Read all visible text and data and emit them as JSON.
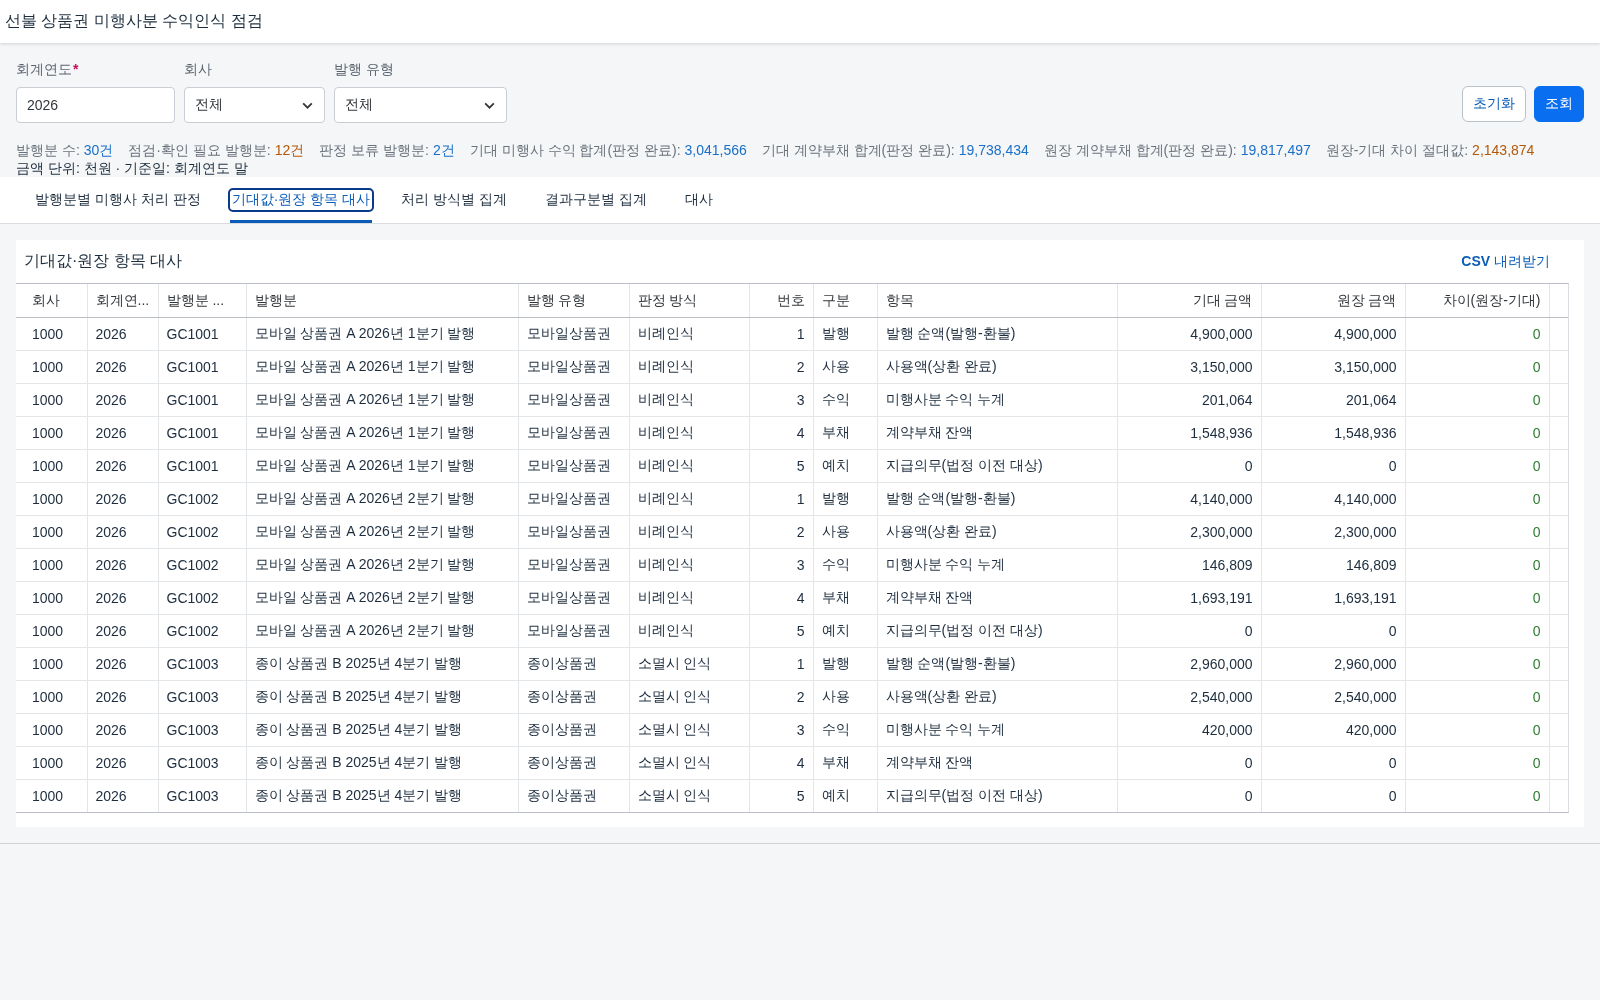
{
  "window": {
    "title": "선불 상품권 미행사분 수익인식 점검"
  },
  "filters": [
    {
      "label": "회계연도",
      "required_mark": "*",
      "kind": "input",
      "value": "2026"
    },
    {
      "label": "회사",
      "kind": "select",
      "value": "전체"
    },
    {
      "label": "발행 유형",
      "kind": "select",
      "value": "전체"
    }
  ],
  "actions": [
    {
      "label": "초기화",
      "kind": "secondary"
    },
    {
      "label": "조회",
      "kind": "primary"
    }
  ],
  "summary": [
    {
      "label": "발행분 수:",
      "value": "30건",
      "color": "#1a6fc9"
    },
    {
      "label": "점검·확인 필요 발행분:",
      "value": "12건",
      "color": "#b4580a"
    },
    {
      "label": "판정 보류 발행분:",
      "value": "2건",
      "color": "#1a6fc9"
    },
    {
      "label": "기대 미행사 수익 합계(판정 완료):",
      "value": "3,041,566",
      "color": "#1a6fc9"
    },
    {
      "label": "기대 계약부채 합계(판정 완료):",
      "value": "19,738,434",
      "color": "#1a6fc9"
    },
    {
      "label": "원장 계약부채 합계(판정 완료):",
      "value": "19,817,497",
      "color": "#1a6fc9"
    },
    {
      "label": "원장-기대 차이 절대값:",
      "value": "2,143,874",
      "color": "#b4580a"
    }
  ],
  "note": "금액 단위: 천원 · 기준일: 회계연도 말",
  "tabs": [
    {
      "label": "발행분별 미행사 처리 판정",
      "selected": false
    },
    {
      "label": "기대값·원장 항목 대사",
      "selected": true
    },
    {
      "label": "처리 방식별 집계",
      "selected": false
    },
    {
      "label": "결과구분별 집계",
      "selected": false
    },
    {
      "label": "대사",
      "selected": false
    }
  ],
  "panel": {
    "title": "기대값·원장 항목 대사",
    "export_link": {
      "bold": "CSV",
      "text": "내려받기"
    }
  },
  "table": {
    "columns": [
      {
        "label": "회사",
        "kind": "text"
      },
      {
        "label": "회계연...",
        "kind": "text"
      },
      {
        "label": "발행분 ...",
        "kind": "text"
      },
      {
        "label": "발행분",
        "kind": "text"
      },
      {
        "label": "발행 유형",
        "kind": "text"
      },
      {
        "label": "판정 방식",
        "kind": "text"
      },
      {
        "label": "번호",
        "kind": "number"
      },
      {
        "label": "구분",
        "kind": "text"
      },
      {
        "label": "항목",
        "kind": "text"
      },
      {
        "label": "기대 금액",
        "kind": "number"
      },
      {
        "label": "원장 금액",
        "kind": "number"
      },
      {
        "label": "차이(원장-기대)",
        "kind": "diff"
      }
    ],
    "rows": [
      [
        "1000",
        "2026",
        "GC1001",
        "모바일 상품권 A 2026년 1분기 발행",
        "모바일상품권",
        "비례인식",
        "1",
        "발행",
        "발행 순액(발행-환불)",
        "4,900,000",
        "4,900,000",
        "0"
      ],
      [
        "1000",
        "2026",
        "GC1001",
        "모바일 상품권 A 2026년 1분기 발행",
        "모바일상품권",
        "비례인식",
        "2",
        "사용",
        "사용액(상환 완료)",
        "3,150,000",
        "3,150,000",
        "0"
      ],
      [
        "1000",
        "2026",
        "GC1001",
        "모바일 상품권 A 2026년 1분기 발행",
        "모바일상품권",
        "비례인식",
        "3",
        "수익",
        "미행사분 수익 누계",
        "201,064",
        "201,064",
        "0"
      ],
      [
        "1000",
        "2026",
        "GC1001",
        "모바일 상품권 A 2026년 1분기 발행",
        "모바일상품권",
        "비례인식",
        "4",
        "부채",
        "계약부채 잔액",
        "1,548,936",
        "1,548,936",
        "0"
      ],
      [
        "1000",
        "2026",
        "GC1001",
        "모바일 상품권 A 2026년 1분기 발행",
        "모바일상품권",
        "비례인식",
        "5",
        "예치",
        "지급의무(법정 이전 대상)",
        "0",
        "0",
        "0"
      ],
      [
        "1000",
        "2026",
        "GC1002",
        "모바일 상품권 A 2026년 2분기 발행",
        "모바일상품권",
        "비례인식",
        "1",
        "발행",
        "발행 순액(발행-환불)",
        "4,140,000",
        "4,140,000",
        "0"
      ],
      [
        "1000",
        "2026",
        "GC1002",
        "모바일 상품권 A 2026년 2분기 발행",
        "모바일상품권",
        "비례인식",
        "2",
        "사용",
        "사용액(상환 완료)",
        "2,300,000",
        "2,300,000",
        "0"
      ],
      [
        "1000",
        "2026",
        "GC1002",
        "모바일 상품권 A 2026년 2분기 발행",
        "모바일상품권",
        "비례인식",
        "3",
        "수익",
        "미행사분 수익 누계",
        "146,809",
        "146,809",
        "0"
      ],
      [
        "1000",
        "2026",
        "GC1002",
        "모바일 상품권 A 2026년 2분기 발행",
        "모바일상품권",
        "비례인식",
        "4",
        "부채",
        "계약부채 잔액",
        "1,693,191",
        "1,693,191",
        "0"
      ],
      [
        "1000",
        "2026",
        "GC1002",
        "모바일 상품권 A 2026년 2분기 발행",
        "모바일상품권",
        "비례인식",
        "5",
        "예치",
        "지급의무(법정 이전 대상)",
        "0",
        "0",
        "0"
      ],
      [
        "1000",
        "2026",
        "GC1003",
        "종이 상품권 B 2025년 4분기 발행",
        "종이상품권",
        "소멸시 인식",
        "1",
        "발행",
        "발행 순액(발행-환불)",
        "2,960,000",
        "2,960,000",
        "0"
      ],
      [
        "1000",
        "2026",
        "GC1003",
        "종이 상품권 B 2025년 4분기 발행",
        "종이상품권",
        "소멸시 인식",
        "2",
        "사용",
        "사용액(상환 완료)",
        "2,540,000",
        "2,540,000",
        "0"
      ],
      [
        "1000",
        "2026",
        "GC1003",
        "종이 상품권 B 2025년 4분기 발행",
        "종이상품권",
        "소멸시 인식",
        "3",
        "수익",
        "미행사분 수익 누계",
        "420,000",
        "420,000",
        "0"
      ],
      [
        "1000",
        "2026",
        "GC1003",
        "종이 상품권 B 2025년 4분기 발행",
        "종이상품권",
        "소멸시 인식",
        "4",
        "부채",
        "계약부채 잔액",
        "0",
        "0",
        "0"
      ],
      [
        "1000",
        "2026",
        "GC1003",
        "종이 상품권 B 2025년 4분기 발행",
        "종이상품권",
        "소멸시 인식",
        "5",
        "예치",
        "지급의무(법정 이전 대상)",
        "0",
        "0",
        "0"
      ]
    ]
  }
}
